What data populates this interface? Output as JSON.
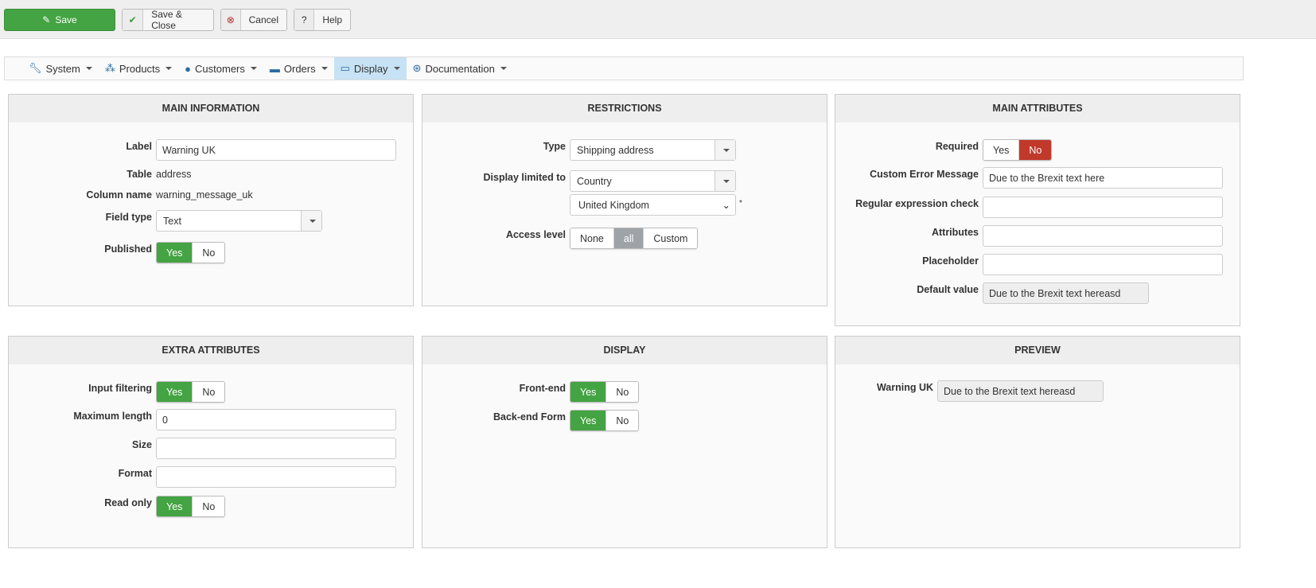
{
  "toolbar": {
    "save": "Save",
    "save_close": "Save & Close",
    "cancel": "Cancel",
    "help": "Help"
  },
  "nav": [
    "System",
    "Products",
    "Customers",
    "Orders",
    "Display",
    "Documentation"
  ],
  "main_info": {
    "title": "MAIN INFORMATION",
    "label_l": "Label",
    "label_v": "Warning UK",
    "table_l": "Table",
    "table_v": "address",
    "col_l": "Column name",
    "col_v": "warning_message_uk",
    "ft_l": "Field type",
    "ft_v": "Text",
    "pub_l": "Published",
    "yes": "Yes",
    "no": "No"
  },
  "restrictions": {
    "title": "RESTRICTIONS",
    "type_l": "Type",
    "type_v": "Shipping address",
    "dl_l": "Display limited to",
    "dl_v": "Country",
    "country_v": "United Kingdom",
    "req": "*",
    "al_l": "Access level",
    "none": "None",
    "all": "all",
    "custom": "Custom"
  },
  "main_attr": {
    "title": "MAIN ATTRIBUTES",
    "req_l": "Required",
    "yes": "Yes",
    "no": "No",
    "cem_l": "Custom Error Message",
    "cem_v": "Due to the Brexit text here",
    "re_l": "Regular expression check",
    "attr_l": "Attributes",
    "ph_l": "Placeholder",
    "dv_l": "Default value",
    "dv_v": "Due to the Brexit text hereasd"
  },
  "extra": {
    "title": "EXTRA ATTRIBUTES",
    "if_l": "Input filtering",
    "ml_l": "Maximum length",
    "ml_v": "0",
    "size_l": "Size",
    "fmt_l": "Format",
    "ro_l": "Read only",
    "yes": "Yes",
    "no": "No"
  },
  "display": {
    "title": "DISPLAY",
    "fe_l": "Front-end",
    "be_l": "Back-end Form",
    "yes": "Yes",
    "no": "No"
  },
  "preview": {
    "title": "PREVIEW",
    "w_l": "Warning UK",
    "w_v": "Due to the Brexit text hereasd"
  }
}
